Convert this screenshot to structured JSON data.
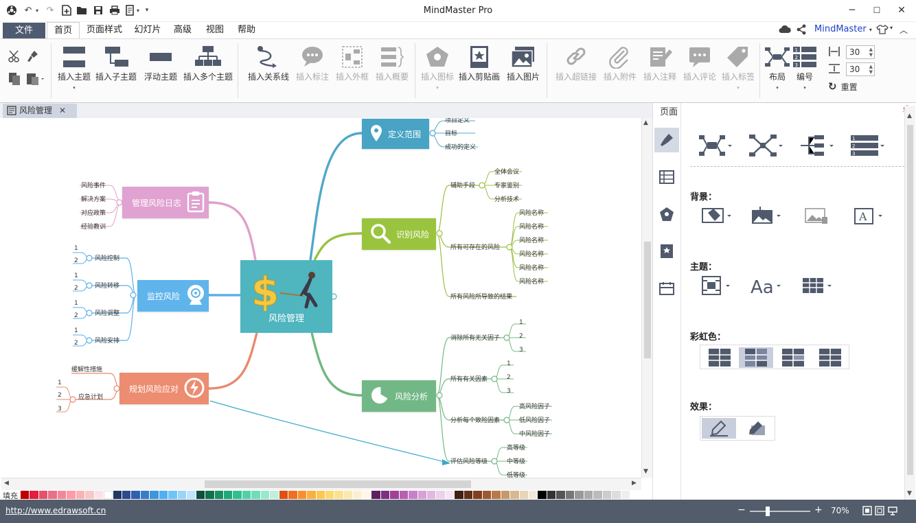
{
  "app": {
    "title": "MindMaster Pro",
    "brand": "MindMaster"
  },
  "menu": {
    "file": "文件",
    "tabs": [
      "首页",
      "页面样式",
      "幻灯片",
      "高级",
      "视图",
      "帮助"
    ]
  },
  "ribbon": {
    "insert_topic": "插入主题",
    "insert_subtopic": "插入子主题",
    "floating_topic": "浮动主题",
    "insert_multiple": "插入多个主题",
    "insert_relation": "插入关系线",
    "insert_callout": "插入标注",
    "insert_boundary": "插入外框",
    "insert_summary": "插入概要",
    "insert_icon": "插入图标",
    "insert_clipart": "插入剪贴画",
    "insert_image": "插入图片",
    "insert_hyperlink": "插入超链接",
    "insert_attachment": "插入附件",
    "insert_note": "插入注释",
    "insert_comment": "插入评论",
    "insert_tag": "插入标签",
    "layout": "布局",
    "numbering": "编号",
    "spacing_h": "30",
    "spacing_v": "30",
    "reset": "重置"
  },
  "doc_tab": {
    "title": "风险管理"
  },
  "mindmap": {
    "central": "风险管理",
    "define": {
      "title": "定义范围",
      "leaves": [
        "项目定义",
        "目标",
        "成功的定义"
      ]
    },
    "identify": {
      "title": "识别风险",
      "aids": "辅助手段",
      "aid_leaves": [
        "全体会议",
        "专家鉴别",
        "分析技术"
      ],
      "possible": "所有可存在的风险",
      "possible_leaves": [
        "风险名称",
        "风险名称",
        "风险名称",
        "风险名称",
        "风险名称",
        "风险名称"
      ],
      "result": "所有风险所导致的结果"
    },
    "analysis": {
      "title": "风险分析",
      "eliminate": "消除所有无关因子",
      "eliminate_leaves": [
        "1",
        "2",
        "3"
      ],
      "related": "所有有关因素",
      "related_leaves": [
        "1",
        "2",
        "3"
      ],
      "each": "分析每个致险因素",
      "each_leaves": [
        "高风险因子",
        "低风险因子",
        "中风险因子"
      ],
      "grade": "评估风险等级",
      "grade_leaves": [
        "高等级",
        "中等级",
        "低等级"
      ]
    },
    "log": {
      "title": "管理风险日志",
      "leaves": [
        "风险事件",
        "解决方案",
        "对应政策",
        "经验教训"
      ]
    },
    "monitor": {
      "title": "监控风险",
      "subs": [
        {
          "label": "风险控制",
          "n": [
            "1",
            "2"
          ]
        },
        {
          "label": "风险转移",
          "n": [
            "1",
            "2"
          ]
        },
        {
          "label": "风险调整",
          "n": [
            "1",
            "2"
          ]
        },
        {
          "label": "风险安排",
          "n": [
            "1",
            "2"
          ]
        }
      ]
    },
    "plan": {
      "title": "规划风险应对",
      "mitigate": "缓解性措施",
      "contingency": "应急计划",
      "n": [
        "1",
        "2",
        "3"
      ]
    }
  },
  "palette": {
    "label": "填充",
    "colors": [
      "#c00000",
      "#e0203c",
      "#e8506a",
      "#e87088",
      "#f08898",
      "#ff9aa8",
      "#f8b4b4",
      "#f8c8c8",
      "#fce0e4",
      "#ffffff",
      "#203864",
      "#2e4a8c",
      "#3060b0",
      "#3a7cc8",
      "#3c96dc",
      "#50b0f0",
      "#70c4f4",
      "#9ad4f8",
      "#c0e4fc",
      "#0c5040",
      "#107050",
      "#189060",
      "#20a878",
      "#30c090",
      "#50d0a8",
      "#70ddb8",
      "#98e8cc",
      "#c0f0dc",
      "#e05010",
      "#f07020",
      "#f89030",
      "#f8b040",
      "#fcc850",
      "#fcd870",
      "#fce090",
      "#fce8b0",
      "#fcf0d0",
      "#fff8e8",
      "#602060",
      "#803080",
      "#a04098",
      "#b860b0",
      "#c880c8",
      "#d8a0d8",
      "#e0b8e0",
      "#ecd0ec",
      "#f4e4f4",
      "#402010",
      "#603018",
      "#804020",
      "#a05830",
      "#b87848",
      "#c89868",
      "#d8b890",
      "#e8d4b8",
      "#f4e8d8",
      "#000000",
      "#333333",
      "#555555",
      "#777777",
      "#999999",
      "#aaaaaa",
      "#bbbbbb",
      "#cccccc",
      "#dddddd",
      "#eeeeee"
    ]
  },
  "panel": {
    "title": "页面",
    "background": "背景：",
    "theme": "主题：",
    "rainbow": "彩虹色：",
    "effect": "效果："
  },
  "status": {
    "url": "http://www.edrawsoft.cn",
    "zoom": "70%",
    "zoom_level": 0.3
  }
}
